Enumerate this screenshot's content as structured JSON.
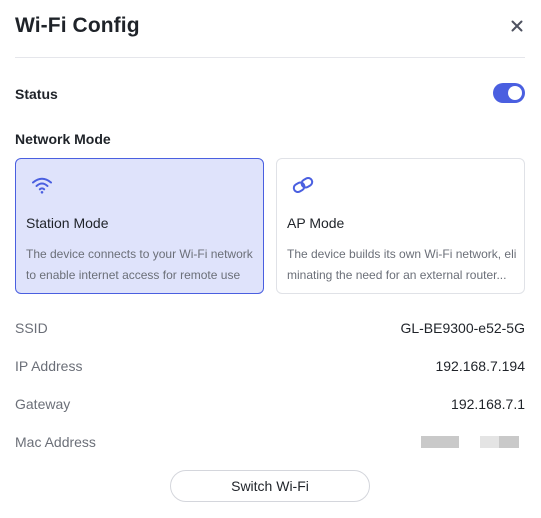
{
  "dialog": {
    "title": "Wi-Fi Config",
    "close_icon": "close-icon"
  },
  "status": {
    "label": "Status",
    "enabled": true
  },
  "network_mode": {
    "label": "Network Mode",
    "selected": "station",
    "options": [
      {
        "id": "station",
        "icon": "wifi-icon",
        "title": "Station Mode",
        "description": "The device connects to your Wi-Fi network to enable internet access for remote use"
      },
      {
        "id": "ap",
        "icon": "link-icon",
        "title": "AP Mode",
        "description": "The device builds its own Wi-Fi network, eliminating the need for an external router..."
      }
    ]
  },
  "info": {
    "ssid": {
      "label": "SSID",
      "value": "GL-BE9300-e52-5G"
    },
    "ip": {
      "label": "IP Address",
      "value": "192.168.7.194"
    },
    "gateway": {
      "label": "Gateway",
      "value": "192.168.7.1"
    },
    "mac": {
      "label": "Mac Address",
      "value": ""
    }
  },
  "actions": {
    "switch_label": "Switch Wi-Fi"
  },
  "colors": {
    "accent": "#4a5fe0",
    "selected_bg": "#dfe3fb"
  }
}
